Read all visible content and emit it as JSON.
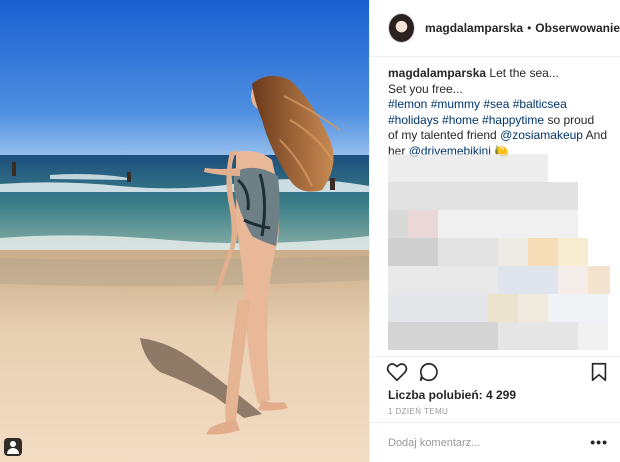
{
  "post": {
    "username": "magdalamparska",
    "follow_separator": "•",
    "follow_label": "Obserwowanie",
    "caption": {
      "user": "magdalamparska",
      "line1": "Let the sea...",
      "line2": "Set you free...",
      "tags_line1": "#lemon #mummy #sea #balticsea",
      "tags_line2": "#holidays #home #happytime",
      "text_after_tags": "so proud",
      "line4": "of my talented friend",
      "mention1": "@zosiamakeup",
      "and_text": "And",
      "her_text": "her",
      "mention2": "@drivemebikini",
      "emoji": "🍋"
    },
    "likes_label": "Liczba polubień: 4 299",
    "time_label": "1 DZIEŃ TEMU",
    "comment_placeholder": "Dodaj komentarz...",
    "more_icon": "•••"
  },
  "icons": {
    "like": "heart-icon",
    "comment": "comment-bubble-icon",
    "save": "bookmark-icon",
    "tagged": "user-tag-icon"
  },
  "colors": {
    "hashtag": "#003569",
    "text": "#262626",
    "muted": "#999999",
    "border": "#efefef"
  }
}
